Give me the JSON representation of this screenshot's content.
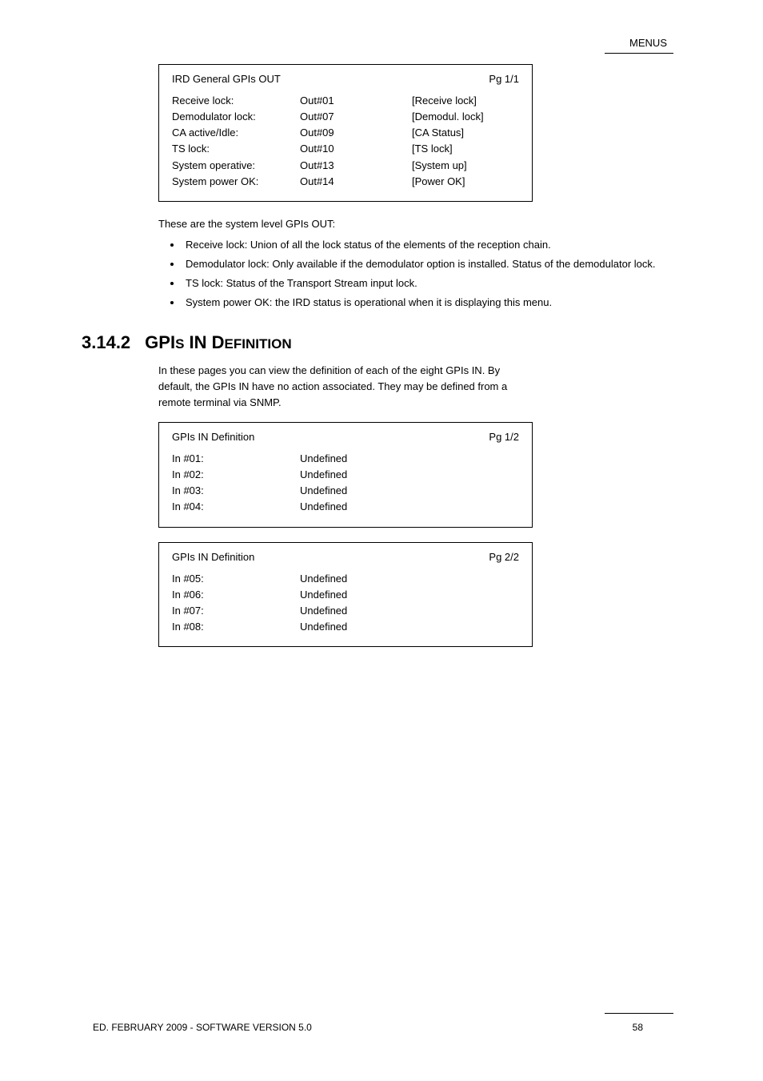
{
  "header": {
    "text": "MENUS"
  },
  "footer": {
    "left": "ED. FEBRUARY 2009 - SOFTWARE VERSION 5.0",
    "right": "58"
  },
  "box1": {
    "titleLeft": "IRD General GPIs OUT",
    "titleRight": "Pg 1/1",
    "rows": [
      {
        "c1": "Receive lock:",
        "c2": "Out#01",
        "c3": "[Receive lock]"
      },
      {
        "c1": "Demodulator lock:",
        "c2": "Out#07",
        "c3": "[Demodul. lock]"
      },
      {
        "c1": "CA active/Idle:",
        "c2": "Out#09",
        "c3": "[CA Status]"
      },
      {
        "c1": "TS lock:",
        "c2": "Out#10",
        "c3": "[TS lock]"
      },
      {
        "c1": "System operative:",
        "c2": "Out#13",
        "c3": "[System up]"
      },
      {
        "c1": "System power OK:",
        "c2": "Out#14",
        "c3": "[Power OK]"
      }
    ]
  },
  "midText": "These are the system level GPIs OUT:",
  "bullets": [
    "Receive lock: Union of all the lock status of the elements of the reception chain.",
    "Demodulator lock: Only available if the demodulator option is installed. Status of the demodulator lock.",
    "TS lock: Status of the Transport Stream input lock.",
    "System power OK: the IRD status is operational when it is displaying this menu."
  ],
  "section": {
    "num": "3.14.2",
    "titlePre": "GPI",
    "titleSm1": "S",
    "titleMid": " IN D",
    "titleSm2": "EFINITION"
  },
  "subText": "In these pages you can view the definition of each of the eight GPIs IN. By default, the GPIs IN have no action associated. They may be defined from a remote terminal via SNMP.",
  "box2": {
    "titleLeft": "GPIs IN Definition",
    "titleRight": "Pg 1/2",
    "rows": [
      {
        "c1": "In #01:",
        "c2": "Undefined"
      },
      {
        "c1": "In #02:",
        "c2": "Undefined"
      },
      {
        "c1": "In #03:",
        "c2": "Undefined"
      },
      {
        "c1": "In #04:",
        "c2": "Undefined"
      }
    ]
  },
  "box3": {
    "titleLeft": "GPIs IN Definition",
    "titleRight": "Pg 2/2",
    "rows": [
      {
        "c1": "In #05:",
        "c2": "Undefined"
      },
      {
        "c1": "In #06:",
        "c2": "Undefined"
      },
      {
        "c1": "In #07:",
        "c2": "Undefined"
      },
      {
        "c1": "In #08:",
        "c2": "Undefined"
      }
    ]
  }
}
